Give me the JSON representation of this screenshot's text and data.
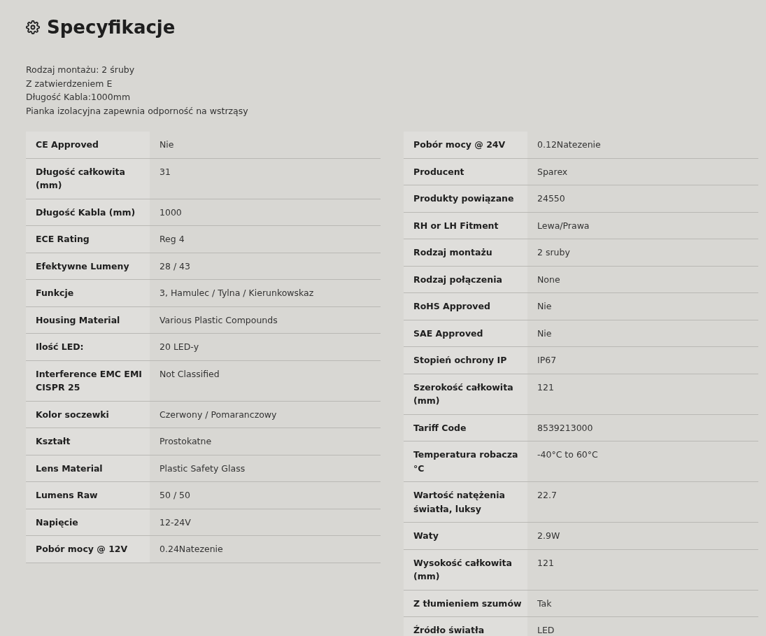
{
  "heading": "Specyfikacje",
  "description": [
    "Rodzaj montażu: 2 śruby",
    "Z zatwierdzeniem E",
    "Długość Kabla:1000mm",
    "Pianka izolacyjna zapewnia odporność na wstrząsy"
  ],
  "tables": [
    {
      "rows": [
        {
          "label": "CE Approved",
          "value": "Nie"
        },
        {
          "label": "Długość całkowita (mm)",
          "value": "31"
        },
        {
          "label": "Długość Kabla (mm)",
          "value": "1000"
        },
        {
          "label": "ECE Rating",
          "value": "Reg 4"
        },
        {
          "label": "Efektywne Lumeny",
          "value": "28 / 43"
        },
        {
          "label": "Funkcje",
          "value": "3, Hamulec / Tylna / Kierunkowskaz"
        },
        {
          "label": "Housing Material",
          "value": "Various Plastic Compounds"
        },
        {
          "label": "Ilość LED:",
          "value": "20 LED-y"
        },
        {
          "label": "Interference EMC EMI CISPR 25",
          "value": "Not Classified"
        },
        {
          "label": "Kolor soczewki",
          "value": "Czerwony / Pomaranczowy"
        },
        {
          "label": "Kształt",
          "value": "Prostokatne"
        },
        {
          "label": "Lens Material",
          "value": "Plastic Safety Glass"
        },
        {
          "label": "Lumens Raw",
          "value": "50 / 50"
        },
        {
          "label": "Napięcie",
          "value": "12-24V"
        },
        {
          "label": "Pobór mocy @ 12V",
          "value": "0.24Natezenie"
        }
      ]
    },
    {
      "rows": [
        {
          "label": "Pobór mocy @ 24V",
          "value": "0.12Natezenie"
        },
        {
          "label": "Producent",
          "value": "Sparex"
        },
        {
          "label": "Produkty powiązane",
          "value": "24550"
        },
        {
          "label": "RH or LH Fitment",
          "value": "Lewa/Prawa"
        },
        {
          "label": "Rodzaj montażu",
          "value": "2 sruby"
        },
        {
          "label": "Rodzaj połączenia",
          "value": "None"
        },
        {
          "label": "RoHS Approved",
          "value": "Nie"
        },
        {
          "label": "SAE Approved",
          "value": "Nie"
        },
        {
          "label": "Stopień ochrony IP",
          "value": "IP67"
        },
        {
          "label": "Szerokość całkowita (mm)",
          "value": "121"
        },
        {
          "label": "Tariff Code",
          "value": "8539213000"
        },
        {
          "label": "Temperatura robacza °C",
          "value": "-40°C to 60°C"
        },
        {
          "label": "Wartość natężenia światła, luksy",
          "value": "22.7"
        },
        {
          "label": "Waty",
          "value": "2.9W"
        },
        {
          "label": "Wysokość całkowita (mm)",
          "value": "121"
        },
        {
          "label": "Z tłumieniem szumów",
          "value": "Tak"
        },
        {
          "label": "Źródło światła",
          "value": "LED"
        }
      ]
    }
  ]
}
